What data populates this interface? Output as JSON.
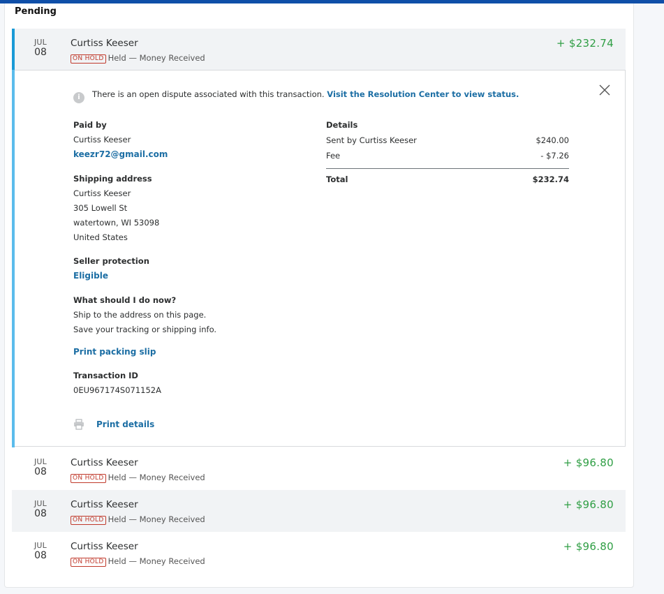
{
  "section": {
    "title": "Pending"
  },
  "expanded": {
    "month": "JUL",
    "day": "08",
    "name": "Curtiss Keeser",
    "badge": "ON HOLD",
    "status": "Held — Money Received",
    "amount": "+ $232.74"
  },
  "notice": {
    "text": "There is an open dispute associated with this transaction. ",
    "link": "Visit the Resolution Center to view status"
  },
  "paid_by": {
    "label": "Paid by",
    "name": "Curtiss Keeser",
    "email": "keezr72@gmail.com"
  },
  "shipping": {
    "label": "Shipping address",
    "lines": [
      "Curtiss Keeser",
      "305 Lowell St",
      "watertown, WI 53098",
      "United States"
    ]
  },
  "seller_protection": {
    "label": "Seller protection",
    "value": "Eligible"
  },
  "what_to_do": {
    "label": "What should I do now?",
    "lines": [
      "Ship to the address on this page.",
      "Save your tracking or shipping info."
    ]
  },
  "print_packing_slip": "Print packing slip",
  "transaction": {
    "label": "Transaction ID",
    "id": "0EU967174S071152A"
  },
  "print_details": "Print details",
  "details": {
    "label": "Details",
    "rows": [
      {
        "label": "Sent by Curtiss Keeser",
        "value": "$240.00"
      },
      {
        "label": "Fee",
        "value": "- $7.26"
      }
    ],
    "total_label": "Total",
    "total_value": "$232.74"
  },
  "transactions": [
    {
      "month": "JUL",
      "day": "08",
      "name": "Curtiss Keeser",
      "badge": "ON HOLD",
      "status": "Held — Money Received",
      "amount": "+ $96.80"
    },
    {
      "month": "JUL",
      "day": "08",
      "name": "Curtiss Keeser",
      "badge": "ON HOLD",
      "status": "Held — Money Received",
      "amount": "+ $96.80"
    },
    {
      "month": "JUL",
      "day": "08",
      "name": "Curtiss Keeser",
      "badge": "ON HOLD",
      "status": "Held — Money Received",
      "amount": "+ $96.80"
    }
  ],
  "colors": {
    "accent_bar": "#1a9ad6",
    "positive": "#2f9e44",
    "link": "#1c6ea4",
    "hold": "#c0392b"
  },
  "icons": {
    "notice": "info-icon",
    "close": "close-icon",
    "print": "printer-icon"
  }
}
